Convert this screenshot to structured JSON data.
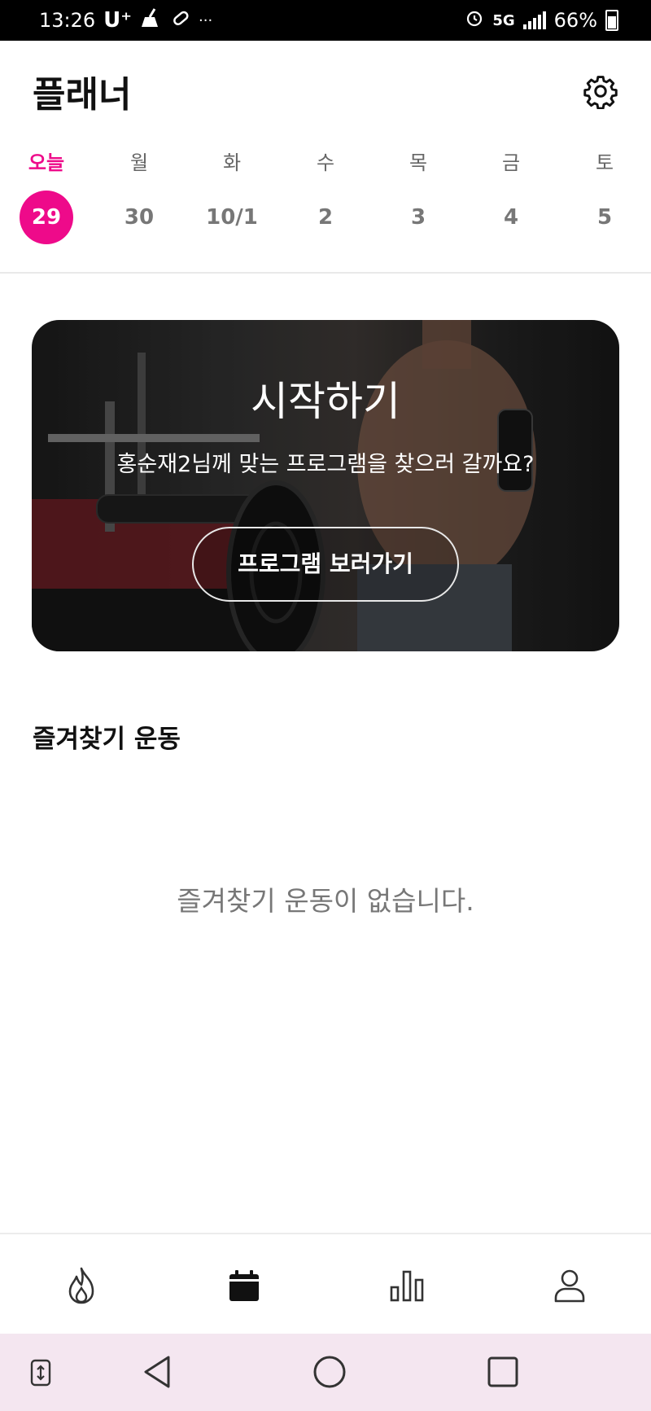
{
  "status_bar": {
    "time": "13:26",
    "carrier": "U⁺",
    "network": "5G",
    "battery": "66%",
    "icons": [
      "broom-icon",
      "pill-icon",
      "more-icon",
      "alarm-icon",
      "signal-icon",
      "battery-icon"
    ]
  },
  "header": {
    "title": "플래너",
    "settings_icon": "gear-icon"
  },
  "week": [
    {
      "name": "오늘",
      "date": "29",
      "today": true
    },
    {
      "name": "월",
      "date": "30"
    },
    {
      "name": "화",
      "date": "10/1"
    },
    {
      "name": "수",
      "date": "2"
    },
    {
      "name": "목",
      "date": "3"
    },
    {
      "name": "금",
      "date": "4"
    },
    {
      "name": "토",
      "date": "5"
    }
  ],
  "banner": {
    "title": "시작하기",
    "subtitle": "홍순재2님께 맞는 프로그램을 찾으러 갈까요?",
    "button_label": "프로그램 보러가기"
  },
  "favorites": {
    "title": "즐겨찾기 운동",
    "empty_message": "즐겨찾기 운동이 없습니다."
  },
  "bottom_nav": {
    "items": [
      "flame-icon",
      "calendar-icon",
      "bar-chart-icon",
      "profile-icon"
    ],
    "active": "calendar-icon"
  },
  "system_nav": [
    "rotate-icon",
    "back-icon",
    "home-icon",
    "recents-icon"
  ],
  "colors": {
    "accent": "#ee0a8a",
    "status_bar_bg": "#000000",
    "system_nav_bg": "#f4e6f0"
  }
}
